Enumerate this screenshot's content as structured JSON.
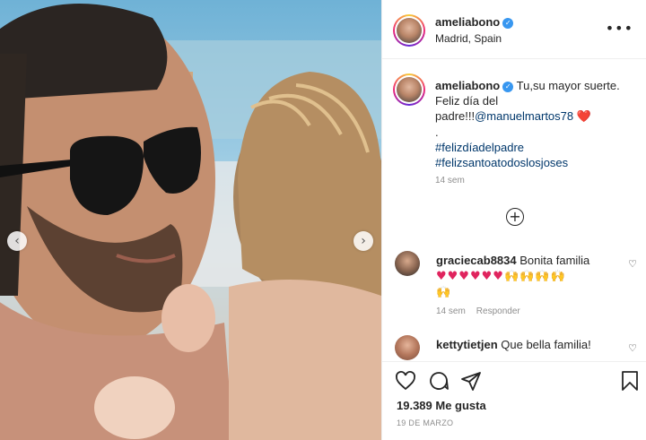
{
  "post": {
    "username": "ameliabono",
    "location": "Madrid, Spain",
    "caption_text": "Tu,su mayor suerte. Feliz día del padre!!!",
    "caption_mention": "@manuelmartos78",
    "caption_heart": "❤️",
    "caption_dot": ".",
    "hashtags": [
      "#felizdíadelpadre",
      "#felizsantoatodoslosjoses"
    ],
    "caption_time": "14 sem",
    "likes": "19.389 Me gusta",
    "date": "19 DE MARZO"
  },
  "comments": [
    {
      "username": "graciecab8834",
      "text": "Bonita familia",
      "emoji_line1_red": "♥♥♥♥♥♥",
      "emoji_line1_hands": "🙌🙌🙌🙌",
      "emoji_line2": "🙌",
      "time": "14 sem",
      "reply_label": "Responder"
    },
    {
      "username": "kettytietjen",
      "text": "Que bella familia!"
    }
  ],
  "icons": {
    "more": "more-options-icon",
    "like": "heart-icon",
    "comment": "comment-icon",
    "share": "share-icon",
    "save": "bookmark-icon",
    "load_more": "plus-circle-icon"
  },
  "colors": {
    "link": "#00376b",
    "verified": "#3897f0",
    "heart": "#ed4956"
  }
}
